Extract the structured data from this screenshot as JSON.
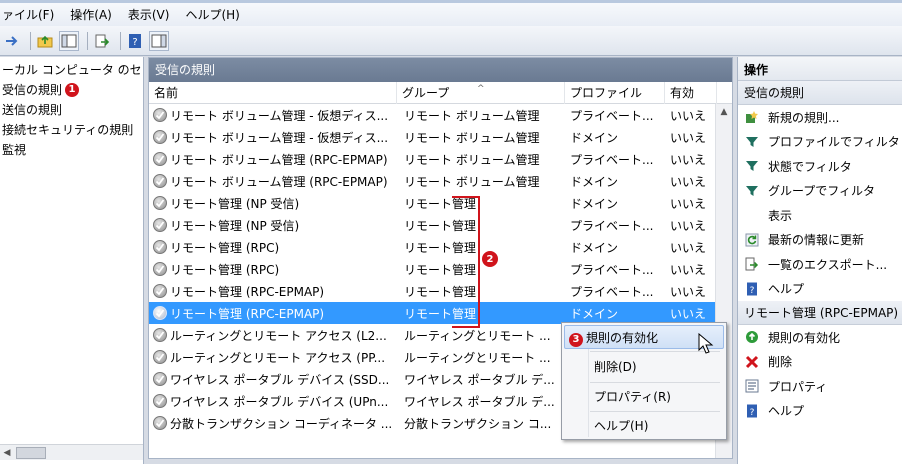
{
  "menu": [
    "ァイル(F)",
    "操作(A)",
    "表示(V)",
    "ヘルプ(H)"
  ],
  "tree": {
    "items": [
      {
        "label": "ーカル コンピュータ のセ",
        "badge": ""
      },
      {
        "label": "受信の規則",
        "badge": "1"
      },
      {
        "label": "送信の規則",
        "badge": ""
      },
      {
        "label": "接続セキュリティの規則",
        "badge": ""
      },
      {
        "label": "監視",
        "badge": ""
      }
    ]
  },
  "center": {
    "title": "受信の規則",
    "columns": [
      "名前",
      "グループ",
      "プロファイル",
      "有効"
    ],
    "rows": [
      {
        "name": "リモート ボリューム管理 - 仮想ディス...",
        "group": "リモート ボリューム管理",
        "profile": "プライベート...",
        "enabled": "いいえ"
      },
      {
        "name": "リモート ボリューム管理 - 仮想ディス...",
        "group": "リモート ボリューム管理",
        "profile": "ドメイン",
        "enabled": "いいえ"
      },
      {
        "name": "リモート ボリューム管理 (RPC-EPMAP)",
        "group": "リモート ボリューム管理",
        "profile": "プライベート...",
        "enabled": "いいえ"
      },
      {
        "name": "リモート ボリューム管理 (RPC-EPMAP)",
        "group": "リモート ボリューム管理",
        "profile": "ドメイン",
        "enabled": "いいえ"
      },
      {
        "name": "リモート管理 (NP 受信)",
        "group": "リモート管理",
        "profile": "ドメイン",
        "enabled": "いいえ"
      },
      {
        "name": "リモート管理 (NP 受信)",
        "group": "リモート管理",
        "profile": "プライベート...",
        "enabled": "いいえ"
      },
      {
        "name": "リモート管理 (RPC)",
        "group": "リモート管理",
        "profile": "ドメイン",
        "enabled": "いいえ"
      },
      {
        "name": "リモート管理 (RPC)",
        "group": "リモート管理",
        "profile": "プライベート...",
        "enabled": "いいえ"
      },
      {
        "name": "リモート管理 (RPC-EPMAP)",
        "group": "リモート管理",
        "profile": "プライベート...",
        "enabled": "いいえ"
      },
      {
        "name": "リモート管理 (RPC-EPMAP)",
        "group": "リモート管理",
        "profile": "ドメイン",
        "enabled": "いいえ"
      },
      {
        "name": "ルーティングとリモート アクセス (L2...",
        "group": "ルーティングとリモート ...",
        "profile": "",
        "enabled": ""
      },
      {
        "name": "ルーティングとリモート アクセス (PP...",
        "group": "ルーティングとリモート ...",
        "profile": "",
        "enabled": ""
      },
      {
        "name": "ワイヤレス ポータブル デバイス (SSD...",
        "group": "ワイヤレス ポータブル デ...",
        "profile": "",
        "enabled": ""
      },
      {
        "name": "ワイヤレス ポータブル デバイス (UPn...",
        "group": "ワイヤレス ポータブル デ...",
        "profile": "",
        "enabled": ""
      },
      {
        "name": "分散トランザクション コーディネータ ...",
        "group": "分散トランザクション コ...",
        "profile": "",
        "enabled": ""
      }
    ],
    "annotation_badge": "2"
  },
  "context_menu": {
    "badge": "3",
    "items": [
      "規則の有効化",
      "削除(D)",
      "プロパティ(R)",
      "ヘルプ(H)"
    ]
  },
  "actions": {
    "header": "操作",
    "section1": "受信の規則",
    "section1_items": [
      {
        "label": "新規の規則...",
        "icon": "new-rule-icon"
      },
      {
        "label": "プロファイルでフィルタ",
        "icon": "filter-icon"
      },
      {
        "label": "状態でフィルタ",
        "icon": "filter-icon"
      },
      {
        "label": "グループでフィルタ",
        "icon": "filter-icon"
      },
      {
        "label": "表示",
        "icon": ""
      },
      {
        "label": "最新の情報に更新",
        "icon": "refresh-icon"
      },
      {
        "label": "一覧のエクスポート...",
        "icon": "export-icon"
      },
      {
        "label": "ヘルプ",
        "icon": "help-icon"
      }
    ],
    "section2": "リモート管理 (RPC-EPMAP)",
    "section2_items": [
      {
        "label": "規則の有効化",
        "icon": "enable-icon"
      },
      {
        "label": "削除",
        "icon": "delete-icon"
      },
      {
        "label": "プロパティ",
        "icon": "properties-icon"
      },
      {
        "label": "ヘルプ",
        "icon": "help-icon"
      }
    ]
  },
  "selected_row_index": 9,
  "colors": {
    "selection": "#3399ff",
    "annotation": "#d0141c",
    "panel_title": "#6a7a92"
  }
}
